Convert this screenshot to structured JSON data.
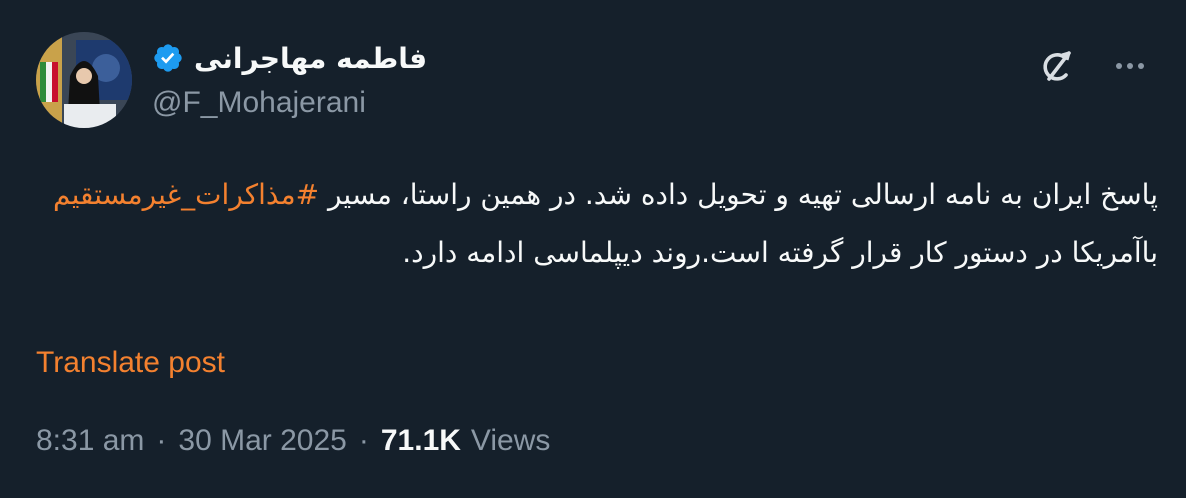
{
  "author": {
    "display_name": "فاطمه مهاجرانی",
    "handle": "@F_Mohajerani",
    "verified": true,
    "avatar_icon": "profile-photo",
    "verified_color": "#1d9bf0"
  },
  "actions": {
    "grok_icon": "grok-icon",
    "more_icon": "more-dots-icon"
  },
  "post": {
    "text_part1": "پاسخ ایران به نامه ارسالی تهیه و تحویل داده شد. در همین راستا، مسیر ",
    "hashtag": "#مذاکرات_غیرمستقیم",
    "text_part2": " باآمریکا در دستور کار قرار گرفته است.روند دیپلماسی ادامه دارد.",
    "translate_label": "Translate post",
    "accent_color": "#f4812f"
  },
  "meta": {
    "time": "8:31 am",
    "date": "30 Mar 2025",
    "separator": "·",
    "views_count": "71.1K",
    "views_label": "Views"
  },
  "theme": {
    "background": "#15202b",
    "text": "#f7f9f9",
    "muted": "#8b98a5"
  }
}
